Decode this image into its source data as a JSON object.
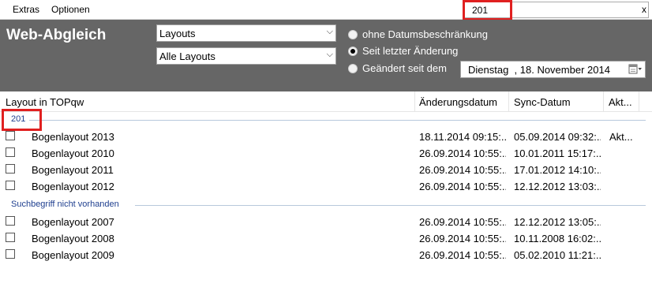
{
  "menu": {
    "items": [
      "Extras",
      "Optionen"
    ]
  },
  "search": {
    "value": "201",
    "clear_label": "x"
  },
  "toolbar": {
    "title": "Web-Abgleich",
    "select_type": "Layouts",
    "select_filter": "Alle Layouts",
    "radios": [
      {
        "label": "ohne Datumsbeschränkung",
        "checked": false
      },
      {
        "label": "Seit letzter Änderung",
        "checked": true
      },
      {
        "label": "Geändert seit dem",
        "checked": false
      }
    ],
    "date_value": "Dienstag  , 18. November 2014"
  },
  "columns": {
    "layout": "Layout in TOPqw",
    "changed": "Änderungsdatum",
    "sync": "Sync-Datum",
    "action": "Akt..."
  },
  "groups": [
    {
      "label": "201",
      "rows": [
        {
          "name": "Bogenlayout 2013",
          "changed": "18.11.2014 09:15:...",
          "sync": "05.09.2014 09:32:...",
          "action": "Akt..."
        },
        {
          "name": "Bogenlayout 2010",
          "changed": "26.09.2014 10:55:...",
          "sync": "10.01.2011 15:17:...",
          "action": ""
        },
        {
          "name": "Bogenlayout 2011",
          "changed": "26.09.2014 10:55:...",
          "sync": "17.01.2012 14:10:...",
          "action": ""
        },
        {
          "name": "Bogenlayout 2012",
          "changed": "26.09.2014 10:55:...",
          "sync": "12.12.2012 13:03:...",
          "action": ""
        }
      ]
    },
    {
      "label": "Suchbegriff nicht vorhanden",
      "rows": [
        {
          "name": "Bogenlayout 2007",
          "changed": "26.09.2014 10:55:...",
          "sync": "12.12.2012 13:05:...",
          "action": ""
        },
        {
          "name": "Bogenlayout 2008",
          "changed": "26.09.2014 10:55:...",
          "sync": "10.11.2008 16:02:...",
          "action": ""
        },
        {
          "name": "Bogenlayout 2009",
          "changed": "26.09.2014 10:55:...",
          "sync": "05.02.2010 11:21:...",
          "action": ""
        }
      ]
    }
  ],
  "colors": {
    "panel": "#666666",
    "highlight": "#e02020",
    "group_text": "#1f3f8f"
  }
}
